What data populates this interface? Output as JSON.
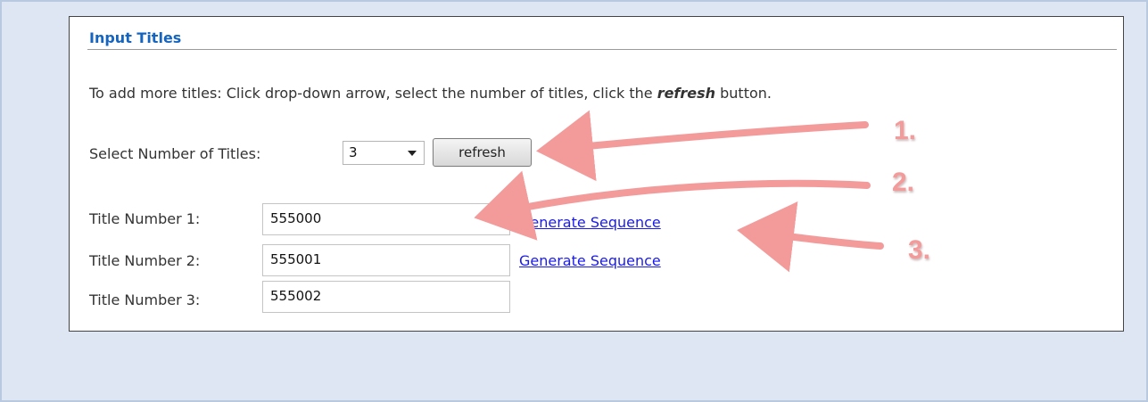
{
  "section": {
    "title": "Input Titles",
    "instructions_before": "To add more titles: Click drop-down arrow, select the number of titles, click the ",
    "instructions_emphasis": "refresh",
    "instructions_after": " button."
  },
  "selector": {
    "label": "Select Number of Titles:",
    "value": "3",
    "refresh_label": "refresh"
  },
  "titles": [
    {
      "label": "Title Number 1:",
      "value": "555000",
      "link": "Generate Sequence"
    },
    {
      "label": "Title Number 2:",
      "value": "555001",
      "link": "Generate Sequence"
    },
    {
      "label": "Title Number 3:",
      "value": "555002"
    }
  ],
  "annotations": {
    "step1": "1.",
    "step2": "2.",
    "step3": "3.",
    "color": "#f39a9a"
  },
  "colors": {
    "title": "#1565c0",
    "link": "#1a1aee",
    "background": "#dde6f2"
  }
}
